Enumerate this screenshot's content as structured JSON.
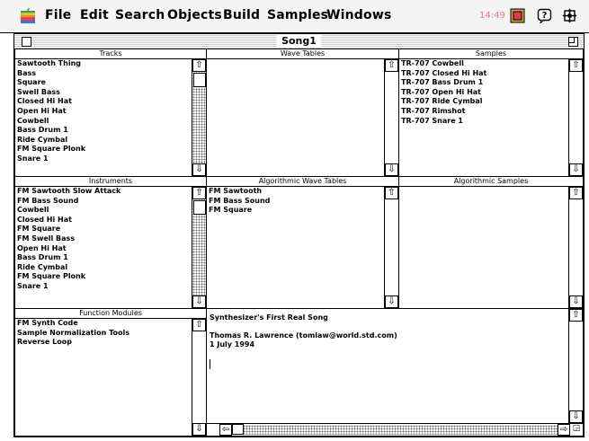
{
  "menubar": {
    "items": [
      "File",
      "Edit",
      "Search",
      "Objects",
      "Build",
      "Samples",
      "Windows"
    ],
    "clock": "14:49"
  },
  "window": {
    "title": "Song1"
  },
  "tracks": {
    "header": "Tracks",
    "items": [
      "Sawtooth Thing",
      "Bass",
      "Square",
      "Swell Bass",
      "Closed Hi Hat",
      "Open Hi Hat",
      "Cowbell",
      "Bass Drum 1",
      "Ride Cymbal",
      "FM Square Plonk",
      "Snare 1"
    ]
  },
  "wave_tables": {
    "header": "Wave Tables",
    "items": []
  },
  "samples": {
    "header": "Samples",
    "items": [
      "TR-707 Cowbell",
      "TR-707 Closed Hi Hat",
      "TR-707 Bass Drum 1",
      "TR-707 Open Hi Hat",
      "TR-707 Ride Cymbal",
      "TR-707 Rimshot",
      "TR-707 Snare 1"
    ]
  },
  "instruments": {
    "header": "Instruments",
    "items": [
      "FM Sawtooth Slow Attack",
      "FM Bass Sound",
      "Cowbell",
      "Closed Hi Hat",
      "FM Square",
      "FM Swell Bass",
      "Open Hi Hat",
      "Bass Drum 1",
      "Ride Cymbal",
      "FM Square Plonk",
      "Snare 1"
    ]
  },
  "algorithmic_wave_tables": {
    "header": "Algorithmic Wave Tables",
    "items": [
      "FM Sawtooth",
      "FM Bass Sound",
      "FM Square"
    ]
  },
  "algorithmic_samples": {
    "header": "Algorithmic Samples",
    "items": []
  },
  "function_modules": {
    "header": "Function Modules",
    "items": [
      "FM Synth Code",
      "Sample Normalization Tools",
      "Reverse Loop"
    ]
  },
  "notes": {
    "text": "Synthesizer's First Real Song\n\nThomas R. Lawrence (tomlaw@world.std.com)\n1 July 1994"
  },
  "icons": {
    "apple": "apple-menu-icon",
    "app": "application-icon",
    "help": "balloon-help-icon",
    "app_menu": "application-menu-icon"
  }
}
